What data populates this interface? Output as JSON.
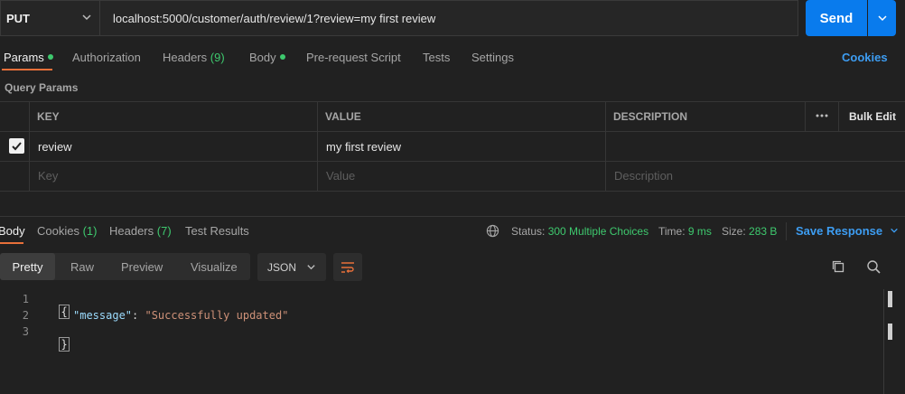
{
  "request": {
    "method": "PUT",
    "url": "localhost:5000/customer/auth/review/1?review=my first review",
    "send_label": "Send"
  },
  "request_tabs": {
    "params": "Params",
    "authorization": "Authorization",
    "headers": "Headers",
    "headers_count": "(9)",
    "body": "Body",
    "pre_request": "Pre-request Script",
    "tests": "Tests",
    "settings": "Settings",
    "cookies": "Cookies"
  },
  "query_params": {
    "title": "Query Params",
    "columns": {
      "key": "KEY",
      "value": "VALUE",
      "description": "DESCRIPTION",
      "bulk_edit": "Bulk Edit"
    },
    "rows": [
      {
        "key": "review",
        "value": "my first review",
        "description": "",
        "checked": true
      }
    ],
    "placeholders": {
      "key": "Key",
      "value": "Value",
      "description": "Description"
    }
  },
  "response_tabs": {
    "body": "Body",
    "cookies": "Cookies",
    "cookies_count": "(1)",
    "headers": "Headers",
    "headers_count": "(7)",
    "test_results": "Test Results"
  },
  "response_status": {
    "status_label": "Status:",
    "status_value": "300 Multiple Choices",
    "time_label": "Time:",
    "time_value": "9 ms",
    "size_label": "Size:",
    "size_value": "283 B",
    "save_response": "Save Response"
  },
  "view_modes": {
    "pretty": "Pretty",
    "raw": "Raw",
    "preview": "Preview",
    "visualize": "Visualize"
  },
  "format": "JSON",
  "code": {
    "line_numbers": [
      "1",
      "2",
      "3"
    ],
    "open_brace": "{",
    "close_brace": "}",
    "key": "\"message\"",
    "colon": ": ",
    "value": "\"Successfully updated\""
  },
  "colors": {
    "accent": "#097bed",
    "tab_active": "#e8703a",
    "success": "#3ec96e",
    "link": "#3d9df2"
  }
}
